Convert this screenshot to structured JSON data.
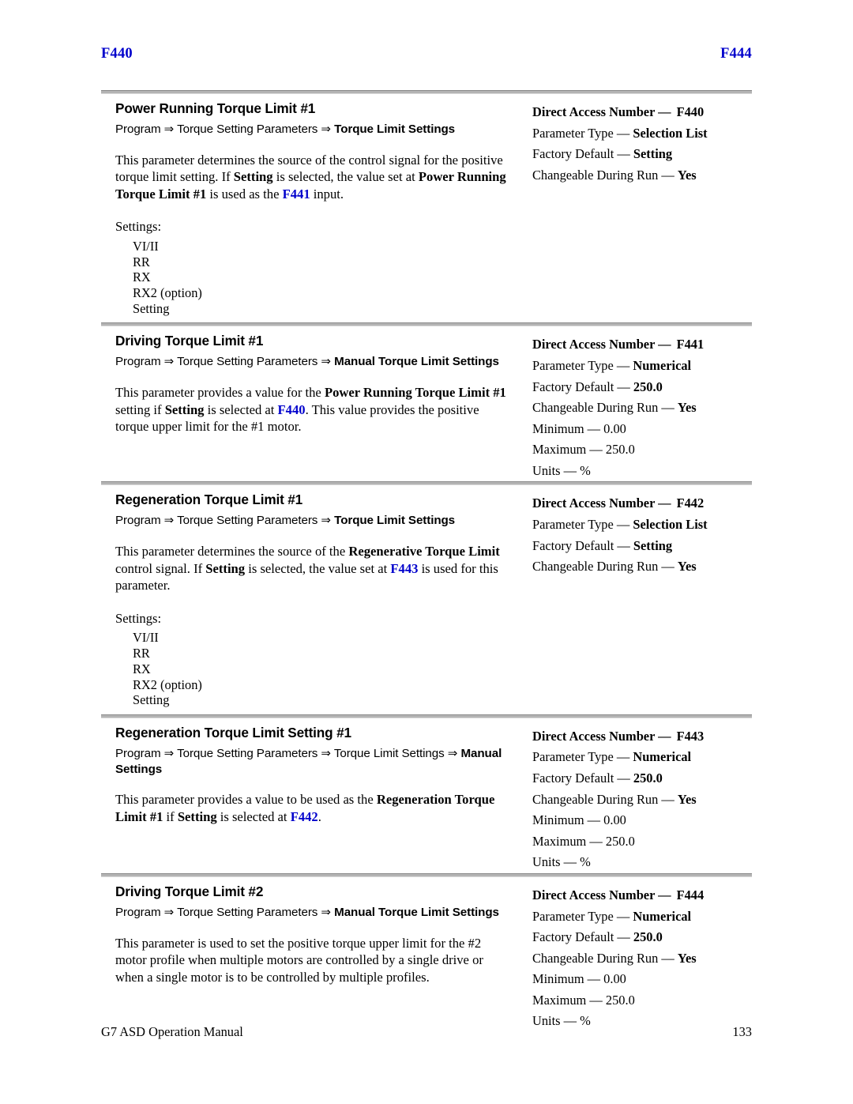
{
  "running_header": {
    "left": "F440",
    "right": "F444",
    "color": "#0000CC"
  },
  "labels": {
    "arrow": "⇒",
    "dash": "—",
    "settings_label": "Settings:",
    "direct_access_number": "Direct Access Number",
    "parameter_type": "Parameter Type",
    "factory_default": "Factory Default",
    "changeable_during_run": "Changeable During Run",
    "minimum": "Minimum",
    "maximum": "Maximum",
    "units": "Units"
  },
  "sections": [
    {
      "title": "Power Running Torque Limit #1",
      "breadcrumb": {
        "prefix": "Program ⇒ Torque Setting Parameters ⇒ ",
        "bold_tail": "Torque Limit Settings"
      },
      "paragraph": {
        "p1": "This parameter determines the source of the control signal for the positive torque limit setting. If ",
        "b1": "Setting",
        "p2": " is selected, the value set at ",
        "ref1": "F441",
        "p3": " is used as the ",
        "b2": "Power Running Torque Limit #1",
        "p4": " input."
      },
      "settings_options": [
        "VI/II",
        "RR",
        "RX",
        "RX2 (option)",
        "Setting"
      ],
      "spec": {
        "direct_access_number": "F440",
        "parameter_type": "Selection List",
        "factory_default": "Setting",
        "changeable_during_run": "Yes"
      }
    },
    {
      "title": "Driving Torque Limit #1",
      "breadcrumb": {
        "prefix": "Program ⇒ Torque Setting Parameters ⇒ ",
        "bold_tail": "Manual Torque Limit Settings"
      },
      "paragraph": {
        "p1": "This parameter provides a value for the ",
        "b1": "Power Running Torque Limit #1",
        "p2": " setting if ",
        "b2": "Setting",
        "p3": " is selected at ",
        "ref1": "F440",
        "p4": ". This value provides the positive torque upper limit for the #1 motor."
      },
      "settings_options": [],
      "spec": {
        "direct_access_number": "F441",
        "parameter_type": "Numerical",
        "factory_default": "250.0",
        "changeable_during_run": "Yes",
        "minimum": "0.00",
        "maximum": "250.0",
        "units": "%"
      }
    },
    {
      "title": "Regeneration Torque Limit #1",
      "breadcrumb": {
        "prefix": "Program ⇒ Torque Setting Parameters ⇒ ",
        "bold_tail": "Torque Limit Settings"
      },
      "paragraph": {
        "p1": "This parameter determines the source of the ",
        "b1": "Regenerative Torque Limit",
        "p2": " control signal. If ",
        "b2": "Setting",
        "p3": " is selected, the value set at ",
        "ref1": "F443",
        "p4": " is used for this parameter."
      },
      "settings_options": [
        "VI/II",
        "RR",
        "RX",
        "RX2 (option)",
        "Setting"
      ],
      "spec": {
        "direct_access_number": "F442",
        "parameter_type": "Selection List",
        "factory_default": "Setting",
        "changeable_during_run": "Yes"
      }
    },
    {
      "title": "Regeneration Torque Limit Setting #1",
      "breadcrumb": {
        "prefix": "Program ⇒ Torque Setting Parameters ⇒ Torque Limit Settings ⇒ ",
        "bold_tail": "Manual Settings"
      },
      "paragraph": {
        "p1": "This parameter provides a value to be used as the ",
        "b1": "Regeneration Torque Limit #1",
        "p2": " if ",
        "b2": "Setting",
        "p3": " is selected at ",
        "ref1": "F442",
        "p4": "."
      },
      "settings_options": [],
      "spec": {
        "direct_access_number": "F443",
        "parameter_type": "Numerical",
        "factory_default": "250.0",
        "changeable_during_run": "Yes",
        "minimum": "0.00",
        "maximum": "250.0",
        "units": "%"
      }
    },
    {
      "title": "Driving Torque Limit #2",
      "breadcrumb": {
        "prefix": "Program ⇒ Torque Setting Parameters ⇒ ",
        "bold_tail": "Manual Torque Limit Settings"
      },
      "paragraph": {
        "p1": "This parameter is used to set the positive torque upper limit for the #2 motor profile when multiple motors are controlled by a single drive or when a single motor is to be controlled by multiple profiles.",
        "b1": "",
        "p2": "",
        "b2": "",
        "p3": "",
        "ref1": "",
        "p4": ""
      },
      "settings_options": [],
      "spec": {
        "direct_access_number": "F444",
        "parameter_type": "Numerical",
        "factory_default": "250.0",
        "changeable_during_run": "Yes",
        "minimum": "0.00",
        "maximum": "250.0",
        "units": "%"
      }
    }
  ],
  "footer": {
    "manual_title": "G7 ASD Operation Manual",
    "page_number": "133"
  }
}
